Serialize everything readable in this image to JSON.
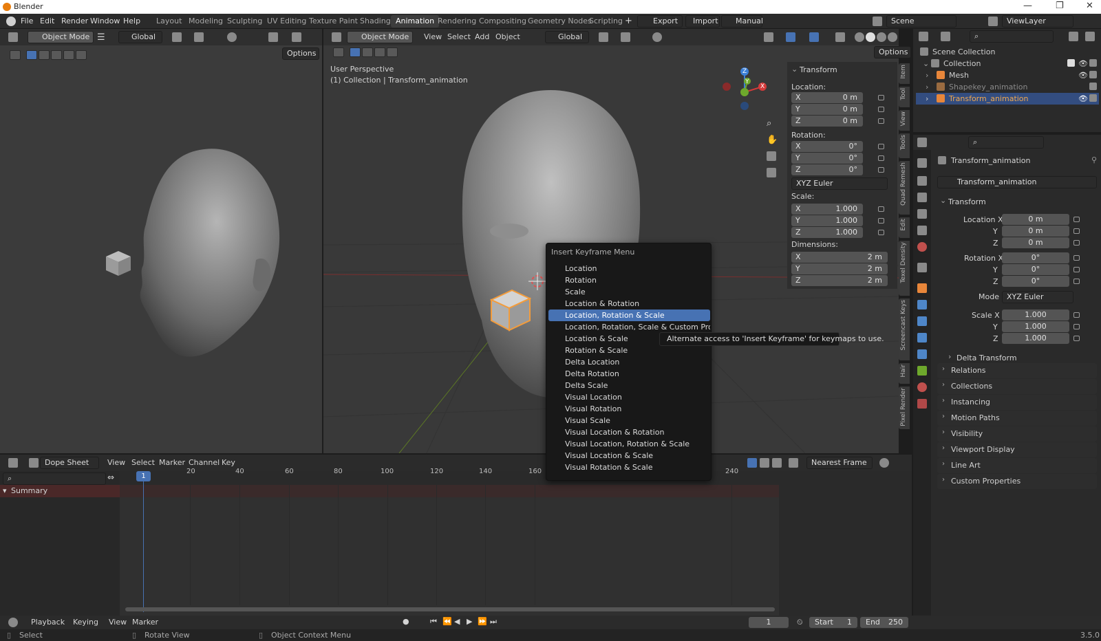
{
  "window": {
    "title": "Blender",
    "min": "—",
    "max": "❐",
    "close": "✕"
  },
  "menubar": {
    "items": [
      "File",
      "Edit",
      "Render",
      "Window",
      "Help"
    ],
    "workspaces": [
      "Layout",
      "Modeling",
      "Sculpting",
      "UV Editing",
      "Texture Paint",
      "Shading",
      "Animation",
      "Rendering",
      "Compositing",
      "Geometry Nodes",
      "Scripting"
    ],
    "active_workspace": "Animation",
    "plus": "+",
    "export": "Export",
    "import": "Import",
    "manual": "Manual",
    "scene": "Scene",
    "viewlayer": "ViewLayer"
  },
  "left_viewport": {
    "mode": "Object Mode",
    "orientation": "Global",
    "options": "Options"
  },
  "main_viewport": {
    "mode": "Object Mode",
    "menus": [
      "View",
      "Select",
      "Add",
      "Object"
    ],
    "orientation": "Global",
    "options": "Options",
    "overlay_line1": "User Perspective",
    "overlay_line2": "(1) Collection | Transform_animation",
    "gizmo_x": "X",
    "gizmo_y": "Y",
    "gizmo_z": "Z"
  },
  "npanel": {
    "title": "Transform",
    "location_label": "Location:",
    "location": [
      [
        "X",
        "0 m"
      ],
      [
        "Y",
        "0 m"
      ],
      [
        "Z",
        "0 m"
      ]
    ],
    "rotation_label": "Rotation:",
    "rotation": [
      [
        "X",
        "0°"
      ],
      [
        "Y",
        "0°"
      ],
      [
        "Z",
        "0°"
      ]
    ],
    "rotation_mode": "XYZ Euler",
    "scale_label": "Scale:",
    "scale": [
      [
        "X",
        "1.000"
      ],
      [
        "Y",
        "1.000"
      ],
      [
        "Z",
        "1.000"
      ]
    ],
    "dimensions_label": "Dimensions:",
    "dimensions": [
      [
        "X",
        "2 m"
      ],
      [
        "Y",
        "2 m"
      ],
      [
        "Z",
        "2 m"
      ]
    ],
    "tabs": [
      "Item",
      "Tool",
      "View",
      "Tools",
      "Quad Remesh",
      "Edit",
      "Texel Density",
      "Screencast Keys",
      "Hair",
      "Pixel Render"
    ]
  },
  "keyframe_menu": {
    "title": "Insert Keyframe Menu",
    "selected_index": 4,
    "items": [
      "Location",
      "Rotation",
      "Scale",
      "Location & Rotation",
      "Location, Rotation & Scale",
      "Location, Rotation, Scale & Custom Properties",
      "Location & Scale",
      "Rotation & Scale",
      "Delta Location",
      "Delta Rotation",
      "Delta Scale",
      "Visual Location",
      "Visual Rotation",
      "Visual Scale",
      "Visual Location & Rotation",
      "Visual Location, Rotation & Scale",
      "Visual Location & Scale",
      "Visual Rotation & Scale"
    ]
  },
  "tooltip": "Alternate access to 'Insert Keyframe' for keymaps to use.",
  "outliner": {
    "scene_collection": "Scene Collection",
    "collection": "Collection",
    "mesh": "Mesh",
    "shapekey": "Shapekey_animation",
    "transform": "Transform_animation"
  },
  "properties": {
    "object_name": "Transform_animation",
    "datablock": "Transform_animation",
    "transform": "Transform",
    "location_x_label": "Location X",
    "y": "Y",
    "z": "Z",
    "loc": [
      "0 m",
      "0 m",
      "0 m"
    ],
    "rotation_x_label": "Rotation X",
    "rot": [
      "0°",
      "0°",
      "0°"
    ],
    "mode_label": "Mode",
    "mode": "XYZ Euler",
    "scale_x_label": "Scale X",
    "scale": [
      "1.000",
      "1.000",
      "1.000"
    ],
    "delta": "Delta Transform",
    "sections": [
      "Relations",
      "Collections",
      "Instancing",
      "Motion Paths",
      "Visibility",
      "Viewport Display",
      "Line Art",
      "Custom Properties"
    ]
  },
  "dopesheet": {
    "editor": "Dope Sheet",
    "menus": [
      "View",
      "Select",
      "Marker",
      "Channel",
      "Key"
    ],
    "snap": "Nearest Frame",
    "summary": "Summary",
    "ticks": [
      "20",
      "40",
      "60",
      "80",
      "100",
      "120",
      "140",
      "160",
      "240"
    ],
    "current_frame": "1"
  },
  "timeline": {
    "menus": [
      "Playback",
      "Keying",
      "View",
      "Marker"
    ],
    "frame": "1",
    "start_label": "Start",
    "start": "1",
    "end_label": "End",
    "end": "250"
  },
  "status": {
    "select": "Select",
    "rotate": "Rotate View",
    "context": "Object Context Menu",
    "version": "3.5.0"
  }
}
